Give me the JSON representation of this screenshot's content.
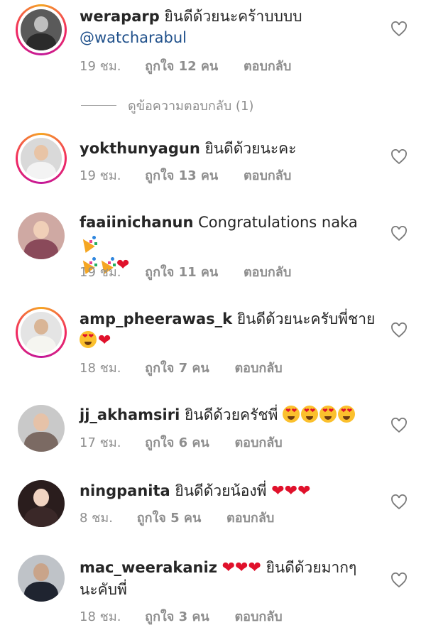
{
  "comments": [
    {
      "username": "weraparp",
      "text": "ยินดีด้วยนะคร้าบบบบ",
      "mention": "@watcharabul",
      "time": "19 ชม.",
      "likes": "ถูกใจ 12 คน",
      "reply": "ตอบกลับ"
    },
    {
      "username": "yokthunyagun",
      "text": "ยินดีด้วยนะคะ",
      "time": "19 ชม.",
      "likes": "ถูกใจ 13 คน",
      "reply": "ตอบกลับ"
    },
    {
      "username": "faaiinichanun",
      "text": "Congratulations naka",
      "time": "19 ชม.",
      "likes": "ถูกใจ 11 คน",
      "reply": "ตอบกลับ"
    },
    {
      "username": "amp_pheerawas_k",
      "text": "ยินดีด้วยนะครับพี่ชาย",
      "time": "18 ชม.",
      "likes": "ถูกใจ 7 คน",
      "reply": "ตอบกลับ"
    },
    {
      "username": "jj_akhamsiri",
      "text": "ยินดีด้วยครัชพี่",
      "time": "17 ชม.",
      "likes": "ถูกใจ 6 คน",
      "reply": "ตอบกลับ"
    },
    {
      "username": "ningpanita",
      "text": "ยินดีด้วยน้องพี่",
      "time": "8 ชม.",
      "likes": "ถูกใจ 5 คน",
      "reply": "ตอบกลับ"
    },
    {
      "username": "mac_weerakaniz",
      "text": "ยินดีด้วยมากๆ นะคับพี่",
      "time": "18 ชม.",
      "likes": "ถูกใจ 3 คน",
      "reply": "ตอบกลับ"
    }
  ],
  "view_replies": "ดูข้อความตอบกลับ (1)",
  "icons": {
    "like": "heart-outline-icon",
    "emoji_heart": "red-heart-emoji",
    "emoji_party": "party-popper-emoji",
    "emoji_love_face": "heart-eyes-emoji"
  },
  "colors": {
    "heart": "#e0112b",
    "meta": "#8e8e8e",
    "mention": "#1e4f8a"
  }
}
